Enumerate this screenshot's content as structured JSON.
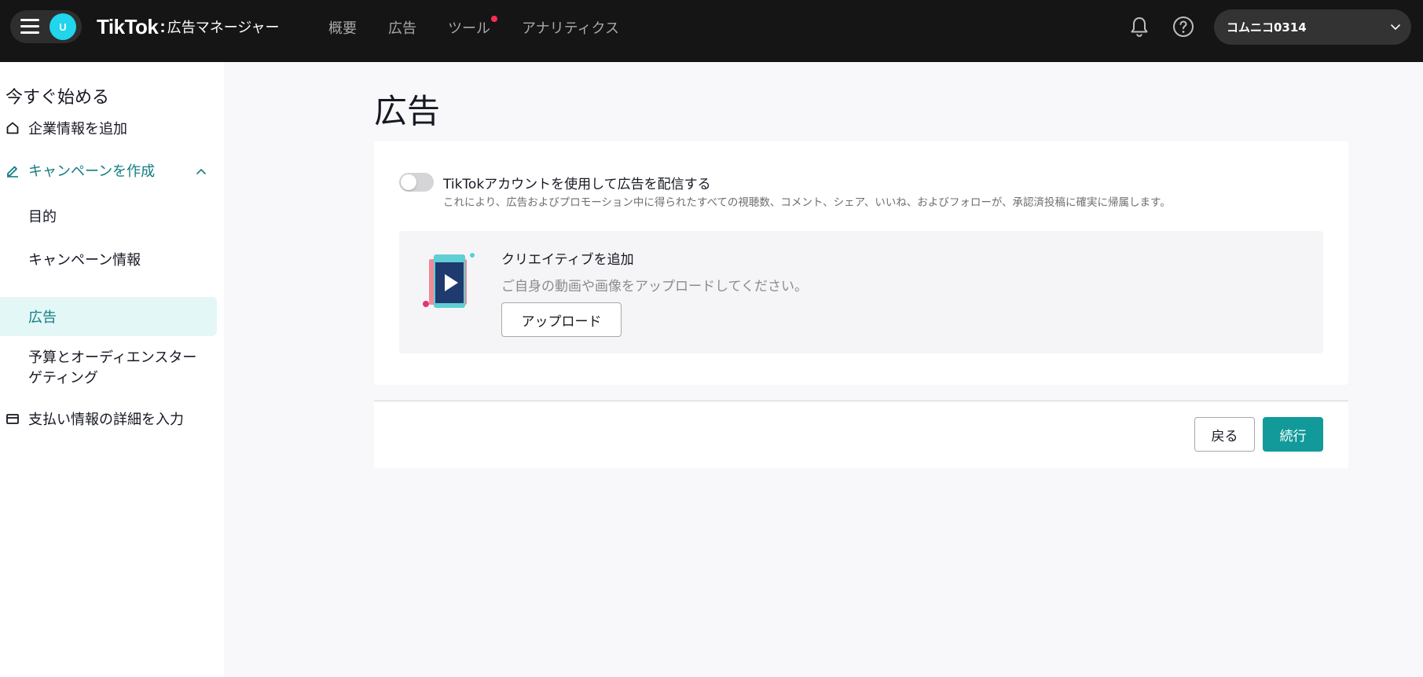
{
  "header": {
    "avatar_initial": "U",
    "logo_text": "TikTok",
    "logo_separator": ":",
    "product_name": "広告マネージャー",
    "nav": [
      {
        "label": "概要"
      },
      {
        "label": "広告"
      },
      {
        "label": "ツール",
        "has_notification": true
      },
      {
        "label": "アナリティクス"
      }
    ],
    "icons": [
      "menu-icon",
      "bell-icon",
      "help-icon",
      "chevron-down-icon"
    ],
    "account_name": "コムニコ0314"
  },
  "sidebar": {
    "heading": "今すぐ始める",
    "items": [
      {
        "label": "企業情報を追加",
        "icon": "home-icon"
      },
      {
        "label": "キャンペーンを作成",
        "icon": "pencil-icon",
        "expanded": true
      },
      {
        "label": "目的"
      },
      {
        "label": "キャンペーン情報"
      },
      {
        "label": "広告",
        "selected": true
      },
      {
        "label": "予算とオーディエンスターゲティング"
      },
      {
        "label": "支払い情報の詳細を入力",
        "icon": "card-icon"
      }
    ]
  },
  "main": {
    "title": "広告",
    "toggle": {
      "on": false,
      "label": "TikTokアカウントを使用して広告を配信する",
      "description": "これにより、広告およびプロモーション中に得られたすべての視聴数、コメント、シェア、いいね、およびフォローが、承認済投稿に確実に帰属します。"
    },
    "creative": {
      "title": "クリエイティブを追加",
      "description": "ご自身の動画や画像をアップロードしてください。",
      "upload_label": "アップロード"
    },
    "footer": {
      "back_label": "戻る",
      "continue_label": "続行"
    }
  },
  "colors": {
    "topbar": "#151515",
    "accent": "#129a9a",
    "accent_text": "#127d80",
    "selected_bg": "#e4f7f7",
    "notification_dot": "#fe2c55"
  }
}
